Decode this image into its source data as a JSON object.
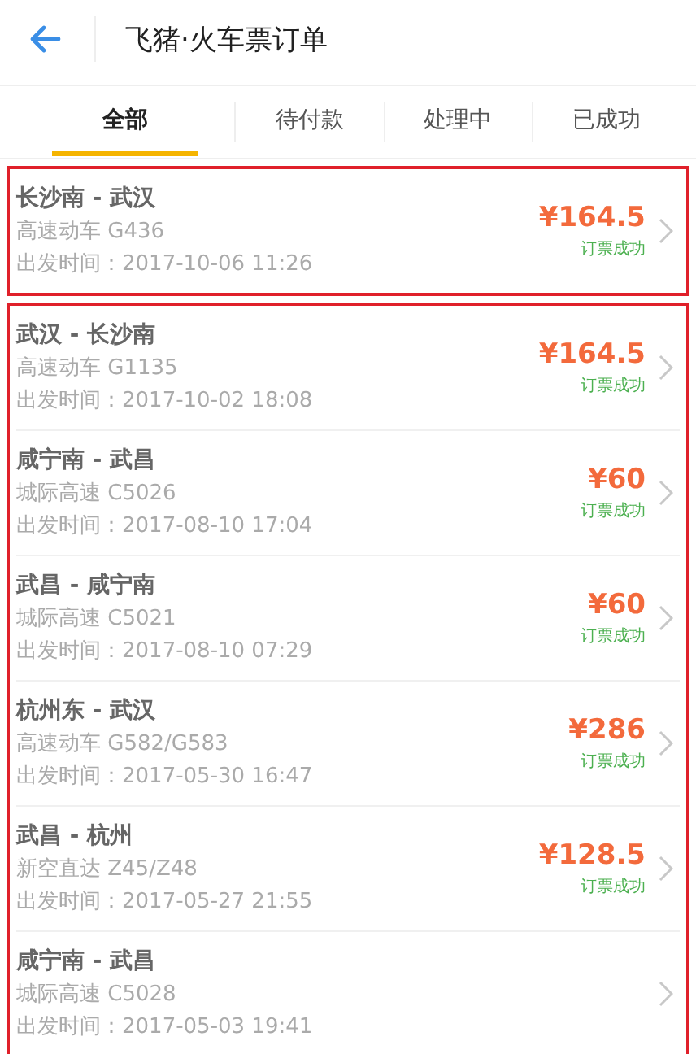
{
  "header": {
    "title": "飞猪·火车票订单"
  },
  "tabs": [
    {
      "label": "全部",
      "selected": true
    },
    {
      "label": "待付款",
      "selected": false
    },
    {
      "label": "处理中",
      "selected": false
    },
    {
      "label": "已成功",
      "selected": false
    }
  ],
  "groups": [
    {
      "orders": [
        {
          "route": "长沙南 - 武汉",
          "train": "高速动车  G436",
          "departure": "出发时间：2017-10-06  11:26",
          "price": "¥164.5",
          "status": "订票成功"
        }
      ]
    },
    {
      "orders": [
        {
          "route": "武汉 - 长沙南",
          "train": "高速动车  G1135",
          "departure": "出发时间：2017-10-02  18:08",
          "price": "¥164.5",
          "status": "订票成功"
        },
        {
          "route": "咸宁南 - 武昌",
          "train": "城际高速  C5026",
          "departure": "出发时间：2017-08-10  17:04",
          "price": "¥60",
          "status": "订票成功"
        },
        {
          "route": "武昌 - 咸宁南",
          "train": "城际高速  C5021",
          "departure": "出发时间：2017-08-10  07:29",
          "price": "¥60",
          "status": "订票成功"
        },
        {
          "route": "杭州东 - 武汉",
          "train": "高速动车  G582/G583",
          "departure": "出发时间：2017-05-30  16:47",
          "price": "¥286",
          "status": "订票成功"
        },
        {
          "route": "武昌 - 杭州",
          "train": "新空直达  Z45/Z48",
          "departure": "出发时间：2017-05-27  21:55",
          "price": "¥128.5",
          "status": "订票成功"
        },
        {
          "route": "咸宁南 - 武昌",
          "train": "城际高速  C5028",
          "departure": "出发时间：2017-05-03  19:41"
        }
      ]
    }
  ]
}
